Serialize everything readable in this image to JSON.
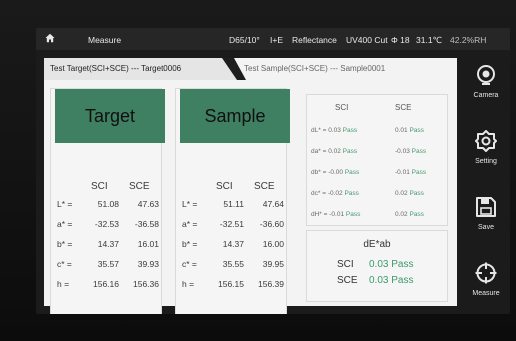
{
  "status_bar": {
    "home_icon": "home-icon",
    "title": "Measure",
    "illuminant": "D65/10°",
    "mode": "I+E",
    "measure_type": "Reflectance",
    "filter": "UV400 Cut",
    "aperture": "Φ 18",
    "temperature": "31.1℃",
    "humidity": "42.2%RH"
  },
  "tabs": {
    "target": "Test Target(SCI+SCE) --- Target0006",
    "sample": "Test Sample(SCI+SCE) --- Sample0001"
  },
  "target": {
    "title": "Target",
    "col_sci": "SCI",
    "col_sce": "SCE",
    "rows": [
      {
        "label": "L* =",
        "sci": "51.08",
        "sce": "47.63"
      },
      {
        "label": "a* =",
        "sci": "-32.53",
        "sce": "-36.58"
      },
      {
        "label": "b* =",
        "sci": "14.37",
        "sce": "16.01"
      },
      {
        "label": "c* =",
        "sci": "35.57",
        "sce": "39.93"
      },
      {
        "label": "h =",
        "sci": "156.16",
        "sce": "156.36"
      }
    ]
  },
  "sample": {
    "title": "Sample",
    "col_sci": "SCI",
    "col_sce": "SCE",
    "rows": [
      {
        "label": "L* =",
        "sci": "51.11",
        "sce": "47.64"
      },
      {
        "label": "a* =",
        "sci": "-32.51",
        "sce": "-36.60"
      },
      {
        "label": "b* =",
        "sci": "14.37",
        "sce": "16.00"
      },
      {
        "label": "c* =",
        "sci": "35.55",
        "sce": "39.95"
      },
      {
        "label": "h =",
        "sci": "156.15",
        "sce": "156.39"
      }
    ]
  },
  "delta": {
    "col_sci": "SCI",
    "col_sce": "SCE",
    "rows": [
      {
        "label": "dL* =",
        "sci": "0.03",
        "sci_status": "Pass",
        "sce": "0.01",
        "sce_status": "Pass"
      },
      {
        "label": "da* =",
        "sci": "0.02",
        "sci_status": "Pass",
        "sce": "-0.03",
        "sce_status": "Pass"
      },
      {
        "label": "db* =",
        "sci": "-0.00",
        "sci_status": "Pass",
        "sce": "-0.01",
        "sce_status": "Pass"
      },
      {
        "label": "dc* =",
        "sci": "-0.02",
        "sci_status": "Pass",
        "sce": "0.02",
        "sce_status": "Pass"
      },
      {
        "label": "dH* =",
        "sci": "-0.01",
        "sci_status": "Pass",
        "sce": "0.02",
        "sce_status": "Pass"
      }
    ]
  },
  "de_ab": {
    "title": "dE*ab",
    "sci_label": "SCI",
    "sci_value": "0.03 Pass",
    "sce_label": "SCE",
    "sce_value": "0.03 Pass"
  },
  "sidebar": {
    "camera": "Camera",
    "setting": "Setting",
    "save": "Save",
    "measure": "Measure"
  },
  "colors": {
    "header_green": "#3f7f62",
    "pass_green": "#4a9a70"
  }
}
